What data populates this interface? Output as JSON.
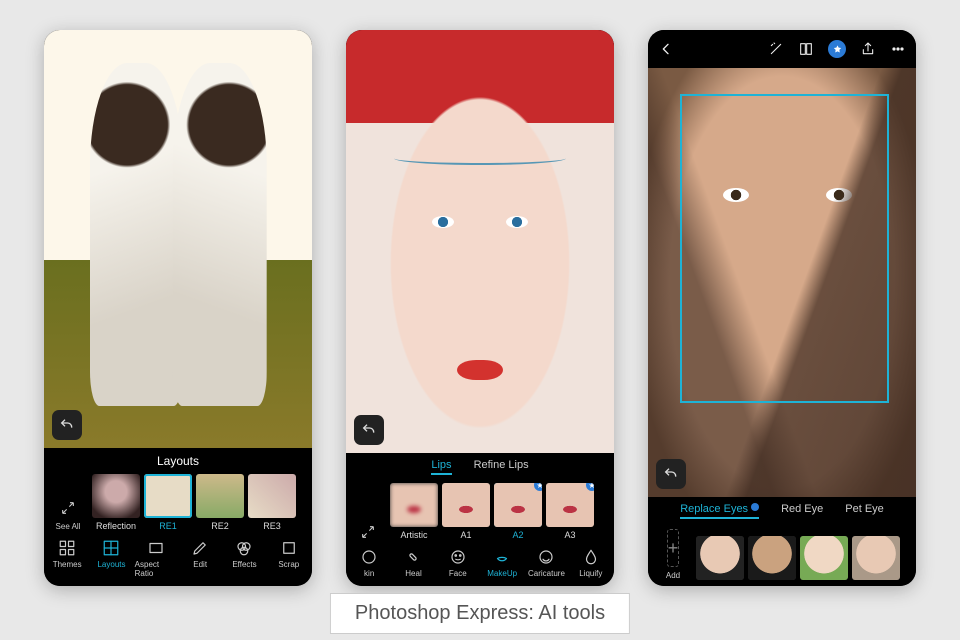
{
  "caption": "Photoshop Express: AI tools",
  "screen1": {
    "section_title": "Layouts",
    "see_all": "See All",
    "thumbs": [
      "Reflection",
      "RE1",
      "RE2",
      "RE3"
    ],
    "selected_thumb": 1,
    "tools": [
      "Themes",
      "Layouts",
      "Aspect Ratio",
      "Edit",
      "Effects",
      "Scrap"
    ],
    "active_tool": 1
  },
  "screen2": {
    "tabs": [
      "Lips",
      "Refine Lips"
    ],
    "active_tab": 0,
    "thumbs": [
      "Artistic",
      "A1",
      "A2",
      "A3"
    ],
    "selected_thumb": 2,
    "premium_thumbs": [
      2,
      3
    ],
    "tools": [
      "kin",
      "Heal",
      "Face",
      "MakeUp",
      "Caricature",
      "Liquify"
    ],
    "active_tool": 3
  },
  "screen3": {
    "tabs": [
      "Replace Eyes",
      "Red Eye",
      "Pet Eye"
    ],
    "active_tab": 0,
    "premium_tabs": [
      0
    ],
    "add_label": "Add"
  }
}
